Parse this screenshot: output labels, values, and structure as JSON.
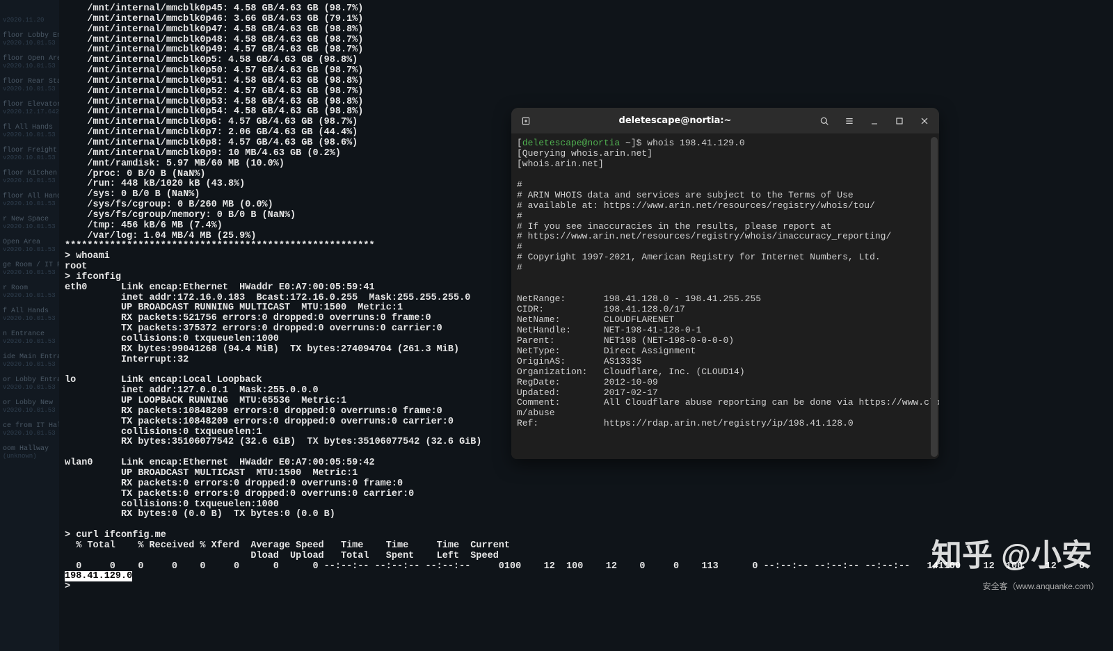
{
  "bg_sidebar": [
    {
      "title": "",
      "sub": "v2020.11.20"
    },
    {
      "title": "floor Lobby Ent",
      "sub": "v2020.10.01.53"
    },
    {
      "title": "floor Open Area",
      "sub": "v2020.10.01.53"
    },
    {
      "title": "floor Rear Stair",
      "sub": "v2020.10.01.53"
    },
    {
      "title": "floor Elevator L",
      "sub": "v2020.12.17.642"
    },
    {
      "title": "fl All Hands",
      "sub": "v2020.10.01.53"
    },
    {
      "title": "floor Freight El",
      "sub": "v2020.10.01.53"
    },
    {
      "title": "floor Kitchen",
      "sub": "v2020.10.01.53"
    },
    {
      "title": "floor All Hands",
      "sub": "v2020.10.01.53"
    },
    {
      "title": "r New Space",
      "sub": "v2020.10.01.53"
    },
    {
      "title": "Open Area",
      "sub": "v2020.10.01.53"
    },
    {
      "title": "ge Room / IT Ro",
      "sub": "v2020.10.01.53"
    },
    {
      "title": "r Room",
      "sub": "v2020.10.01.53"
    },
    {
      "title": "f All Hands",
      "sub": "v2020.10.01.53"
    },
    {
      "title": "n Entrance",
      "sub": "v2020.10.01.53"
    },
    {
      "title": "ide Main Entra",
      "sub": "v2020.10.01.53"
    },
    {
      "title": "or Lobby Entra",
      "sub": "v2020.10.01.53"
    },
    {
      "title": "or Lobby New",
      "sub": "v2020.10.01.53"
    },
    {
      "title": "ce from IT Hall",
      "sub": "v2020.10.01.53"
    },
    {
      "title": "oom Hallway",
      "sub": "(unknown)"
    }
  ],
  "main_terminal": {
    "lines_top": "    /mnt/internal/mmcblk0p45: 4.58 GB/4.63 GB (98.7%)\n    /mnt/internal/mmcblk0p46: 3.66 GB/4.63 GB (79.1%)\n    /mnt/internal/mmcblk0p47: 4.58 GB/4.63 GB (98.8%)\n    /mnt/internal/mmcblk0p48: 4.58 GB/4.63 GB (98.7%)\n    /mnt/internal/mmcblk0p49: 4.57 GB/4.63 GB (98.7%)\n    /mnt/internal/mmcblk0p5: 4.58 GB/4.63 GB (98.8%)\n    /mnt/internal/mmcblk0p50: 4.57 GB/4.63 GB (98.7%)\n    /mnt/internal/mmcblk0p51: 4.58 GB/4.63 GB (98.8%)\n    /mnt/internal/mmcblk0p52: 4.57 GB/4.63 GB (98.7%)\n    /mnt/internal/mmcblk0p53: 4.58 GB/4.63 GB (98.8%)\n    /mnt/internal/mmcblk0p54: 4.58 GB/4.63 GB (98.8%)\n    /mnt/internal/mmcblk0p6: 4.57 GB/4.63 GB (98.7%)\n    /mnt/internal/mmcblk0p7: 2.06 GB/4.63 GB (44.4%)\n    /mnt/internal/mmcblk0p8: 4.57 GB/4.63 GB (98.6%)\n    /mnt/internal/mmcblk0p9: 10 MB/4.63 GB (0.2%)\n    /mnt/ramdisk: 5.97 MB/60 MB (10.0%)\n    /proc: 0 B/0 B (NaN%)\n    /run: 448 kB/1020 kB (43.8%)\n    /sys: 0 B/0 B (NaN%)\n    /sys/fs/cgroup: 0 B/260 MB (0.0%)\n    /sys/fs/cgroup/memory: 0 B/0 B (NaN%)\n    /tmp: 456 kB/6 MB (7.4%)\n    /var/log: 1.04 MB/4 MB (25.9%)\n*******************************************************\n> whoami\nroot\n> ifconfig\neth0      Link encap:Ethernet  HWaddr E0:A7:00:05:59:41\n          inet addr:172.16.0.183  Bcast:172.16.0.255  Mask:255.255.255.0\n          UP BROADCAST RUNNING MULTICAST  MTU:1500  Metric:1\n          RX packets:521756 errors:0 dropped:0 overruns:0 frame:0\n          TX packets:375372 errors:0 dropped:0 overruns:0 carrier:0\n          collisions:0 txqueuelen:1000\n          RX bytes:99041268 (94.4 MiB)  TX bytes:274094704 (261.3 MiB)\n          Interrupt:32\n\nlo        Link encap:Local Loopback\n          inet addr:127.0.0.1  Mask:255.0.0.0\n          UP LOOPBACK RUNNING  MTU:65536  Metric:1\n          RX packets:10848209 errors:0 dropped:0 overruns:0 frame:0\n          TX packets:10848209 errors:0 dropped:0 overruns:0 carrier:0\n          collisions:0 txqueuelen:1\n          RX bytes:35106077542 (32.6 GiB)  TX bytes:35106077542 (32.6 GiB)\n\nwlan0     Link encap:Ethernet  HWaddr E0:A7:00:05:59:42\n          UP BROADCAST MULTICAST  MTU:1500  Metric:1\n          RX packets:0 errors:0 dropped:0 overruns:0 frame:0\n          TX packets:0 errors:0 dropped:0 overruns:0 carrier:0\n          collisions:0 txqueuelen:1000\n          RX bytes:0 (0.0 B)  TX bytes:0 (0.0 B)\n\n> curl ifconfig.me\n  % Total    % Received % Xferd  Average Speed   Time    Time     Time  Current\n                                 Dload  Upload   Total   Spent    Left  Speed\n  0     0    0     0    0     0      0      0 --:--:-- --:--:-- --:--:--     0100    12  100    12    0     0    113      0 --:--:-- --:--:-- --:--:--   141100    12  100    12    0     0",
    "ip_line": "198.41.129.0",
    "prompt_end": "\n> "
  },
  "float_terminal": {
    "title": "deletescape@nortia:~",
    "prompt_user": "deletescape@nortia",
    "prompt_sep": " ~",
    "prompt_end": "]$",
    "cmd": " whois 198.41.129.0",
    "body": "[Querying whois.arin.net]\n[whois.arin.net]\n\n#\n# ARIN WHOIS data and services are subject to the Terms of Use\n# available at: https://www.arin.net/resources/registry/whois/tou/\n#\n# If you see inaccuracies in the results, please report at\n# https://www.arin.net/resources/registry/whois/inaccuracy_reporting/\n#\n# Copyright 1997-2021, American Registry for Internet Numbers, Ltd.\n#\n\n\nNetRange:       198.41.128.0 - 198.41.255.255\nCIDR:           198.41.128.0/17\nNetName:        CLOUDFLARENET\nNetHandle:      NET-198-41-128-0-1\nParent:         NET198 (NET-198-0-0-0-0)\nNetType:        Direct Assignment\nOriginAS:       AS13335\nOrganization:   Cloudflare, Inc. (CLOUD14)\nRegDate:        2012-10-09\nUpdated:        2017-02-17\nComment:        All Cloudflare abuse reporting can be done via https://www.cloudflare.co\nm/abuse\nRef:            https://rdap.arin.net/registry/ip/198.41.128.0"
  },
  "watermark": "知乎 @小安",
  "source_label": "安全客（www.anquanke.com）"
}
